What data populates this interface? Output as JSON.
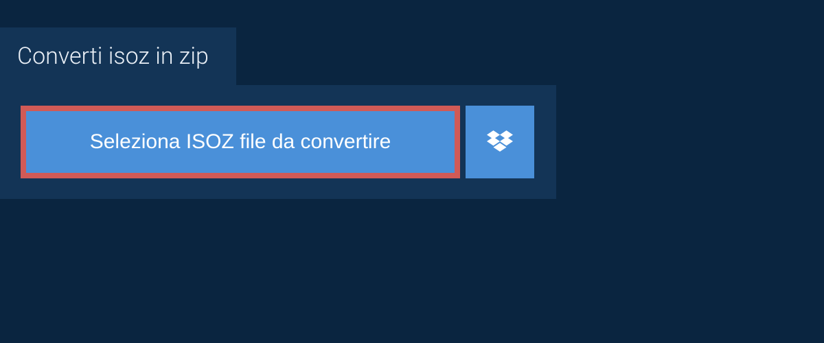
{
  "header": {
    "title": "Converti isoz in zip"
  },
  "actions": {
    "select_file_label": "Seleziona ISOZ file da convertire",
    "dropbox_icon": "dropbox-icon"
  },
  "colors": {
    "background": "#0a2540",
    "panel": "#133456",
    "button_primary": "#4a90d9",
    "button_border_highlight": "#d15a56",
    "text_light": "#e8eef5"
  }
}
